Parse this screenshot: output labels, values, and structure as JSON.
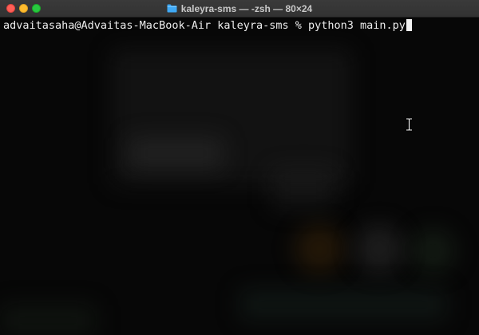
{
  "window": {
    "title": "kaleyra-sms — -zsh — 80×24",
    "title_icon": "folder-icon",
    "controls": [
      "close",
      "minimize",
      "maximize"
    ]
  },
  "terminal": {
    "prompt": "advaitasaha@Advaitas-MacBook-Air kaleyra-sms % ",
    "command": "python3 main.py"
  },
  "colors": {
    "titlebar": "#353535",
    "background": "#070707",
    "text": "#ededed",
    "close": "#fe5f57",
    "minimize": "#febc2e",
    "maximize": "#28c840",
    "folder": "#3fa9f5"
  }
}
